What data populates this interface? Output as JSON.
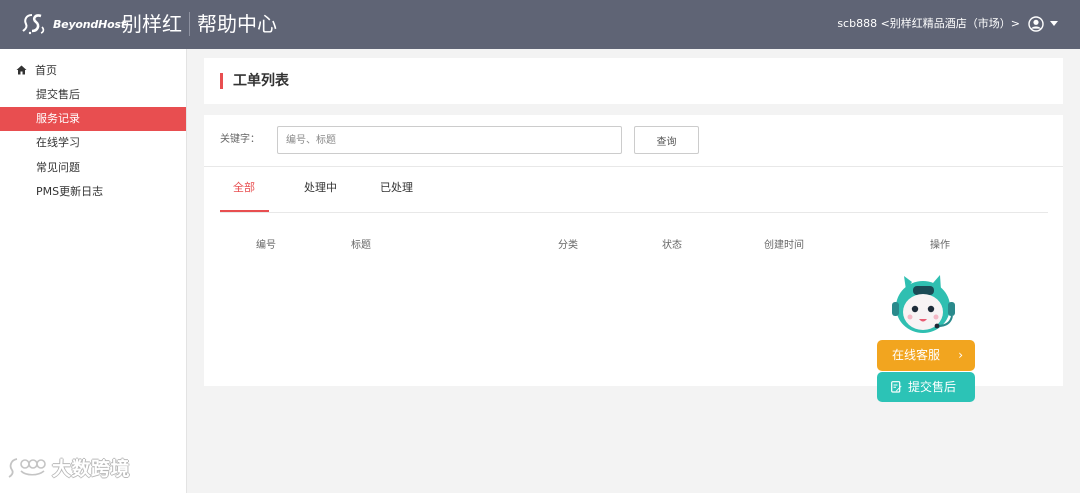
{
  "header": {
    "logo_text": "BeyondHost",
    "brand": "别样红",
    "title": "帮助中心",
    "user": "scb888 <别样红精品酒店（市场）>"
  },
  "sidebar": {
    "home": "首页",
    "items": [
      {
        "label": "提交售后",
        "active": false
      },
      {
        "label": "服务记录",
        "active": true
      },
      {
        "label": "在线学习",
        "active": false
      },
      {
        "label": "常见问题",
        "active": false
      },
      {
        "label": "PMS更新日志",
        "active": false
      }
    ],
    "watermark": "大数跨境"
  },
  "main": {
    "page_title": "工单列表",
    "search": {
      "label": "关键字：",
      "placeholder": "编号、标题",
      "value": "",
      "button": "查询"
    },
    "tabs": [
      {
        "label": "全部",
        "active": true
      },
      {
        "label": "处理中",
        "active": false
      },
      {
        "label": "已处理",
        "active": false
      }
    ],
    "columns": [
      "编号",
      "标题",
      "分类",
      "状态",
      "创建时间",
      "操作"
    ]
  },
  "support": {
    "online_label": "在线客服",
    "aftersale_label": "提交售后",
    "chevron": "›"
  },
  "colors": {
    "topbar": "#5f6475",
    "accent": "#e84e50",
    "online": "#f2a51f",
    "aftersale": "#2cc3b6"
  }
}
